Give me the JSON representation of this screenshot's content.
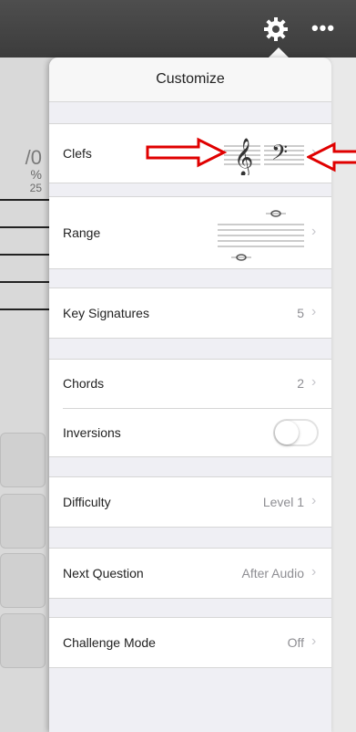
{
  "header": {
    "gear_icon": "gear-icon",
    "more_icon": "more-icon",
    "more_glyph": "•••"
  },
  "background_page": {
    "score": "/0",
    "percent": "%",
    "time": "25"
  },
  "customize": {
    "title": "Customize",
    "rows": {
      "clefs": {
        "label": "Clefs"
      },
      "range": {
        "label": "Range"
      },
      "key_signatures": {
        "label": "Key Signatures",
        "value": "5"
      },
      "chords": {
        "label": "Chords",
        "value": "2"
      },
      "inversions": {
        "label": "Inversions",
        "toggle_on": false
      },
      "difficulty": {
        "label": "Difficulty",
        "value": "Level 1"
      },
      "next_question": {
        "label": "Next Question",
        "value": "After Audio"
      },
      "challenge_mode": {
        "label": "Challenge Mode",
        "value": "Off"
      }
    },
    "chevron": "›",
    "accent_annotation_color": "#e00000"
  }
}
